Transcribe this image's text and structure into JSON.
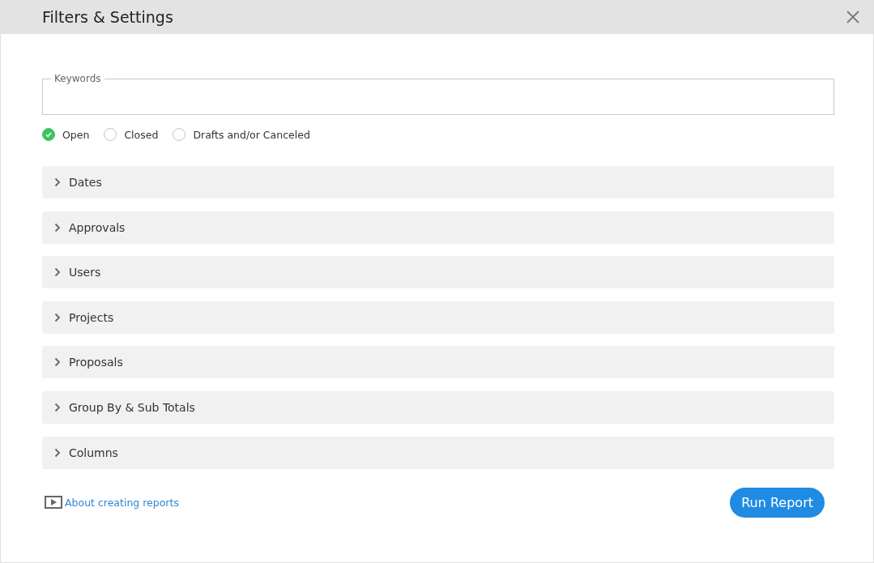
{
  "window": {
    "title": "Filters & Settings"
  },
  "keywords": {
    "label": "Keywords"
  },
  "statuses": [
    {
      "label": "Open",
      "selected": true
    },
    {
      "label": "Closed",
      "selected": false
    },
    {
      "label": "Drafts and/or Canceled",
      "selected": false
    }
  ],
  "sections": [
    {
      "label": "Dates",
      "expanded": false
    },
    {
      "label": "Approvals",
      "expanded": false
    },
    {
      "label": "Users",
      "expanded": false
    },
    {
      "label": "Projects",
      "expanded": false
    },
    {
      "label": "Proposals",
      "expanded": false
    },
    {
      "label": "Group By & Sub Totals",
      "expanded": false
    },
    {
      "label": "Columns",
      "expanded": false
    }
  ],
  "help_link": "About creating reports",
  "run_button": "Run Report"
}
